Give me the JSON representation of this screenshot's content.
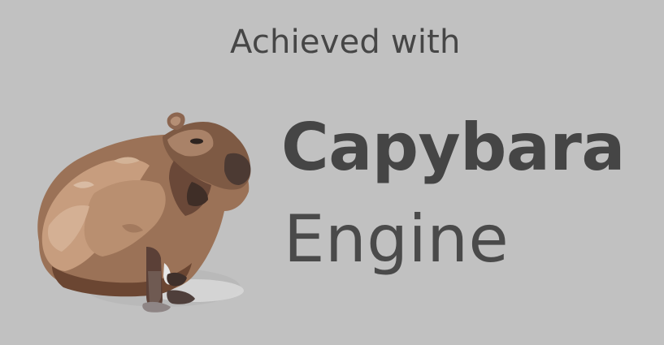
{
  "splash": {
    "tagline": "Achieved with",
    "product_name_line1": "Capybara",
    "product_name_line2": "Engine",
    "mascot_icon": "capybara-icon",
    "colors": {
      "background": "#c1c1c1",
      "text_primary": "#454545",
      "text_secondary": "#464646"
    }
  }
}
